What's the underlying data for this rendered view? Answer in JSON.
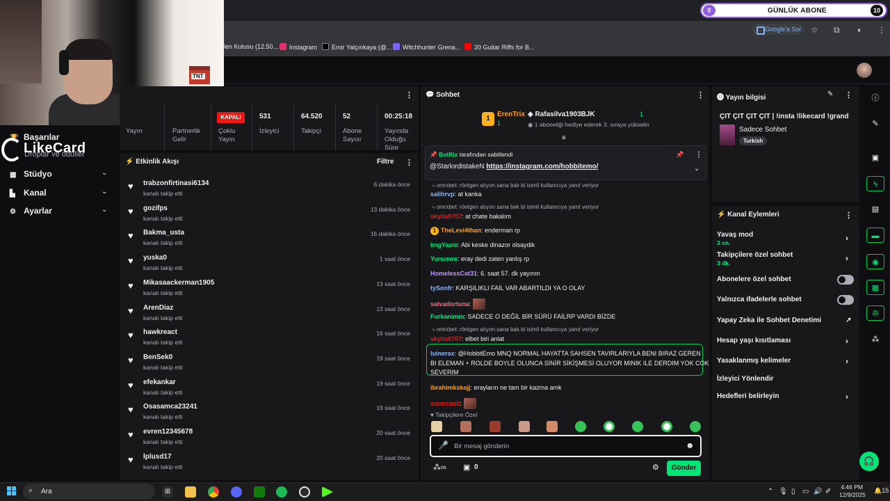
{
  "browser": {
    "bookmarks": [
      {
        "label": "len Kutusu (12.50...",
        "color": "#3c4043"
      },
      {
        "label": "Instagram",
        "color": "#e1306c"
      },
      {
        "label": "Emir Yalçınkaya (@...",
        "color": "#000000"
      },
      {
        "label": "Witchhunter Grena...",
        "color": "#7b61ff"
      },
      {
        "label": "20 Guitar Riffs for B...",
        "color": "#ff0000"
      }
    ],
    "google_chip": "Google'a Sor"
  },
  "overlay": {
    "sub_goal_current": "0",
    "sub_goal_label": "GÜNLÜK ABONE",
    "sub_goal_target": "10",
    "sponsor_text": "LikeCard"
  },
  "nav": {
    "basarilar": "Başarılar",
    "droplar": "Droplar ve ödüller",
    "studyo": "Stüdyo",
    "kanal": "Kanal",
    "ayarlar": "Ayarlar"
  },
  "stats": {
    "status_badge": "KAPALI",
    "cols": [
      {
        "label": "Yayın",
        "value": ""
      },
      {
        "label": "Partnerlik Gelir",
        "value": ""
      },
      {
        "label": "Çoklu Yayın",
        "value": ""
      },
      {
        "label": "İzleyici",
        "value": "531"
      },
      {
        "label": "Takipçi",
        "value": "64.520"
      },
      {
        "label": "Abone Sayısı",
        "value": "52"
      },
      {
        "label": "Yayında Olduğu Süre",
        "value": "00:25:18"
      }
    ]
  },
  "activity": {
    "title": "Etkinlik Akışı",
    "filter": "Filtre",
    "items": [
      {
        "user": "trabzonfirtinasi6134",
        "action": "kanalı takip etti",
        "time": "6 dakika önce"
      },
      {
        "user": "gozifps",
        "action": "kanalı takip etti",
        "time": "13 dakika önce"
      },
      {
        "user": "Bakma_usta",
        "action": "kanalı takip etti",
        "time": "16 dakika önce"
      },
      {
        "user": "yuska0",
        "action": "kanalı takip etti",
        "time": "1 saat önce"
      },
      {
        "user": "Mikasaackerman1905",
        "action": "kanalı takip etti",
        "time": "13 saat önce"
      },
      {
        "user": "ArenDiaz",
        "action": "kanalı takip etti",
        "time": "13 saat önce"
      },
      {
        "user": "hawkreact",
        "action": "kanalı takip etti",
        "time": "16 saat önce"
      },
      {
        "user": "BenSek0",
        "action": "kanalı takip etti",
        "time": "19 saat önce"
      },
      {
        "user": "efekankar",
        "action": "kanalı takip etti",
        "time": "19 saat önce"
      },
      {
        "user": "Osasamca23241",
        "action": "kanalı takip etti",
        "time": "19 saat önce"
      },
      {
        "user": "evren12345678",
        "action": "kanalı takip etti",
        "time": "20 saat önce"
      },
      {
        "user": "lplusd17",
        "action": "kanalı takip etti",
        "time": "20 saat önce"
      }
    ]
  },
  "chat": {
    "title": "Sohbet",
    "top_gifter": {
      "rank": "1",
      "name": "ErenTrix",
      "count": "1"
    },
    "top_gifter2": {
      "name": "Rafasilva1903BJK",
      "count": "1",
      "note": "1 aboneliği hediye ederek 3. sıraya yükselin"
    },
    "pinned": {
      "by_user": "BotRix",
      "by_text": "tarafından sabitlendi",
      "user": "@StarlordistakeN",
      "link": "https://instagram.com/hobbitemo/"
    },
    "messages": [
      {
        "reply": "omrxbet: röntgen atıyım sana bak bi isimli kullanıcıya yanıt veriyor",
        "user": "salihrvp",
        "color": "#8ab4f8",
        "text": "at kanka"
      },
      {
        "reply": "omrxbet: röntgen atıyım sana bak bi isimli kullanıcıya yanıt veriyor",
        "user": "skylla0707",
        "color": "#e91916",
        "text": "at chate bakalım"
      },
      {
        "user": "TheLevi4than",
        "color": "#ff9f1a",
        "text": "enderman rp",
        "badge": "1"
      },
      {
        "user": "kngYasin",
        "color": "#00e676",
        "text": "Abi keske dinazor olsaydik"
      },
      {
        "user": "Yunuswe",
        "color": "#00e676",
        "text": "eray dedi zaten yanlış rp"
      },
      {
        "user": "HomelessCat31",
        "color": "#bf94ff",
        "text": "6. saat 57. dk yayının"
      },
      {
        "user": "tySonfr",
        "color": "#8ab4f8",
        "text": "KARŞILIKLI FAİL VAR ABARTILDI YA O OLAY"
      },
      {
        "user": "salvadortuna",
        "color": "#ff6b81",
        "text": ""
      },
      {
        "user": "Furkanimio",
        "color": "#00e676",
        "text": "SADECE O DEĞİL BİR SÜRÜ FAİLRP VARDI BİZDE"
      },
      {
        "reply": "omrxbet: röntgen atıyım sana bak bi isimli kullanıcıya yanıt veriyor",
        "user": "skylla0707",
        "color": "#e91916",
        "text": "elbet biri anlat"
      },
      {
        "user": "luinerax",
        "color": "#8ab4f8",
        "text": "@HobbitEmo MNQ NORMAL HAYATTA SAHSEN TAVIRLARIYLA BENI BIRAZ GEREN",
        "text2": "BI ELEMAN + ROLDE BOYLE OLUNCA SİNİR SİKİŞMESİ OLUYOR MINIK ILE DERDIM YOK COK",
        "text3": "SEVERIM"
      },
      {
        "user": "ibrahimkskajj",
        "color": "#ff9f1a",
        "text": "erayların ne tam bir kazma amk"
      },
      {
        "user": "omercan0",
        "color": "#e91916",
        "text": ""
      }
    ],
    "follower_only": "Takipçilere Özel",
    "input_placeholder": "Bir mesaj gönderin",
    "points": "0",
    "send_label": "Gönder"
  },
  "stream_info": {
    "title": "Yayın bilgisi",
    "stream_title": "ÇIT ÇIT ÇIT ÇIT | !insta !likecard !grand",
    "category": "Sadece Sohbet",
    "tag": "Turkish"
  },
  "channel_actions": {
    "title": "Kanal Eylemleri",
    "items": [
      {
        "label": "Yavaş mod",
        "sub": "3 sn.",
        "control": "chevron"
      },
      {
        "label": "Takipçilere özel sohbet",
        "sub": "3 dk.",
        "control": "chevron"
      },
      {
        "label": "Abonelere özel sohbet",
        "sub": "",
        "control": "toggle"
      },
      {
        "label": "Yalnızca ifadelerle sohbet",
        "sub": "",
        "control": "toggle"
      },
      {
        "label": "Yapay Zeka ile Sohbet Denetimi",
        "sub": "",
        "control": "external"
      },
      {
        "label": "Hesap yaşı kısıtlaması",
        "sub": "",
        "control": "chevron"
      },
      {
        "label": "Yasaklanmış kelimeler",
        "sub": "",
        "control": "chevron"
      },
      {
        "label": "İzleyici Yönlendir",
        "sub": "",
        "control": "none"
      },
      {
        "label": "Hedefleri belirleyin",
        "sub": "",
        "control": "chevron"
      }
    ]
  },
  "taskbar": {
    "search": "Ara",
    "time": "4:46 PM",
    "date": "12/9/2025",
    "notif": "15"
  }
}
